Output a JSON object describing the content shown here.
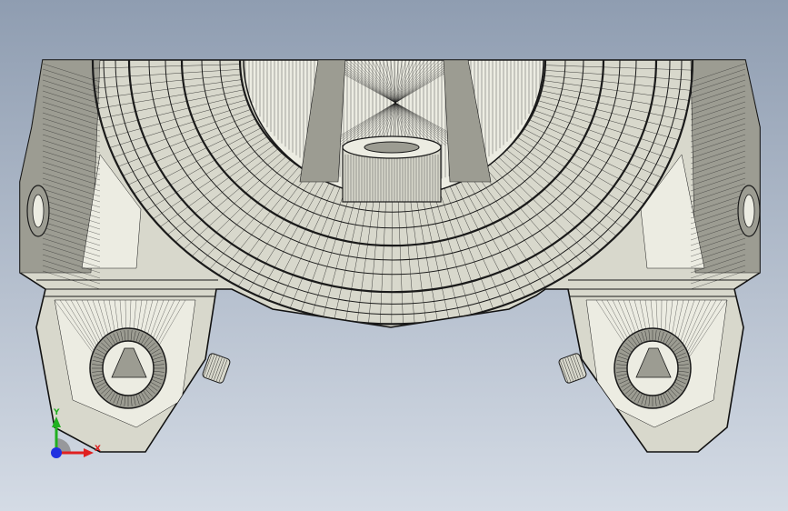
{
  "viewport": {
    "background_top": "#8f9db1",
    "background_bottom": "#d4dbe5",
    "model_fill": "#d8d8cc",
    "model_fill_light": "#ecece2",
    "model_fill_dark": "#9c9c92",
    "mesh_color": "#1a1a1a"
  },
  "triad": {
    "x_label": "X",
    "y_label": "Y",
    "x_color": "#e02020",
    "y_color": "#20b020",
    "z_color": "#2030e0"
  }
}
